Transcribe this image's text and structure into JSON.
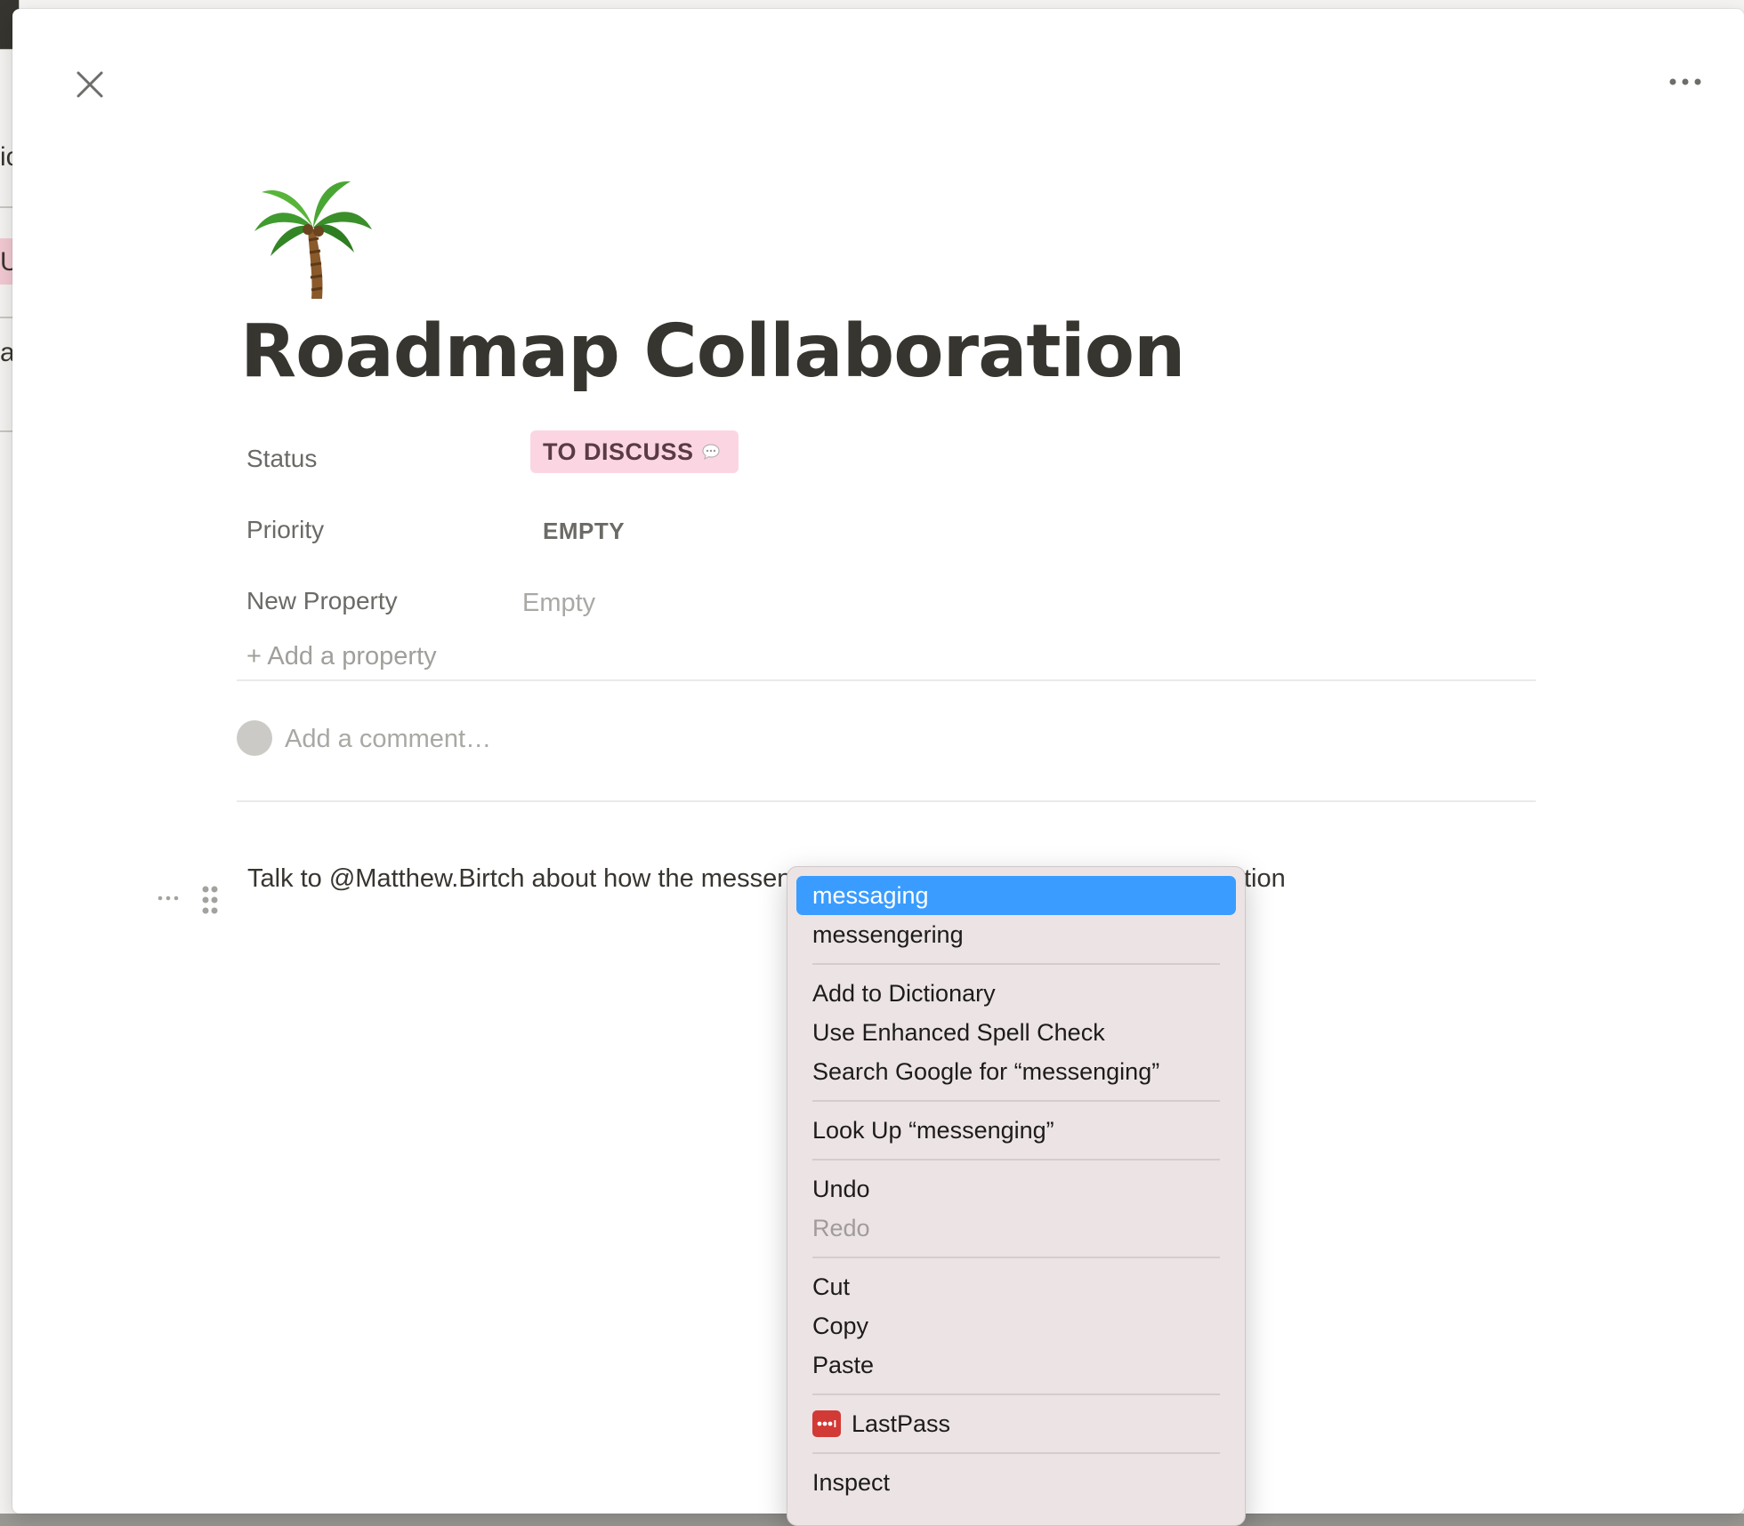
{
  "background_page": {
    "rows": [
      "ic",
      "U",
      "ac"
    ]
  },
  "modal": {
    "page": {
      "icon": "palm-tree-icon",
      "title": "Roadmap Collaboration"
    },
    "properties": [
      {
        "label": "Status",
        "value": "TO DISCUSS",
        "icon": "speech-bubble-icon",
        "color": "#fbd6e2"
      },
      {
        "label": "Priority",
        "value": "EMPTY"
      },
      {
        "label": "New Property",
        "value": "Empty"
      }
    ],
    "add_property_label": "+ Add a property",
    "comment": {
      "placeholder": "Add a comment…"
    },
    "body": {
      "text_start": "Talk to @Matthew.Birtch about how the messen",
      "text_end": "tion"
    }
  },
  "context_menu": {
    "items": [
      {
        "label": "messaging",
        "selected": true
      },
      {
        "label": "messengering"
      },
      {
        "label": "Add to Dictionary"
      },
      {
        "label": "Use Enhanced Spell Check"
      },
      {
        "label": "Search Google for “messenging”"
      },
      {
        "label": "Look Up “messenging”"
      },
      {
        "label": "Undo"
      },
      {
        "label": "Redo",
        "disabled": true
      },
      {
        "label": "Cut"
      },
      {
        "label": "Copy"
      },
      {
        "label": "Paste"
      },
      {
        "label": "LastPass",
        "icon": "lastpass-icon"
      },
      {
        "label": "Inspect"
      }
    ],
    "selected_color": "#3a9cff",
    "lastpass_color": "#d23a35"
  }
}
